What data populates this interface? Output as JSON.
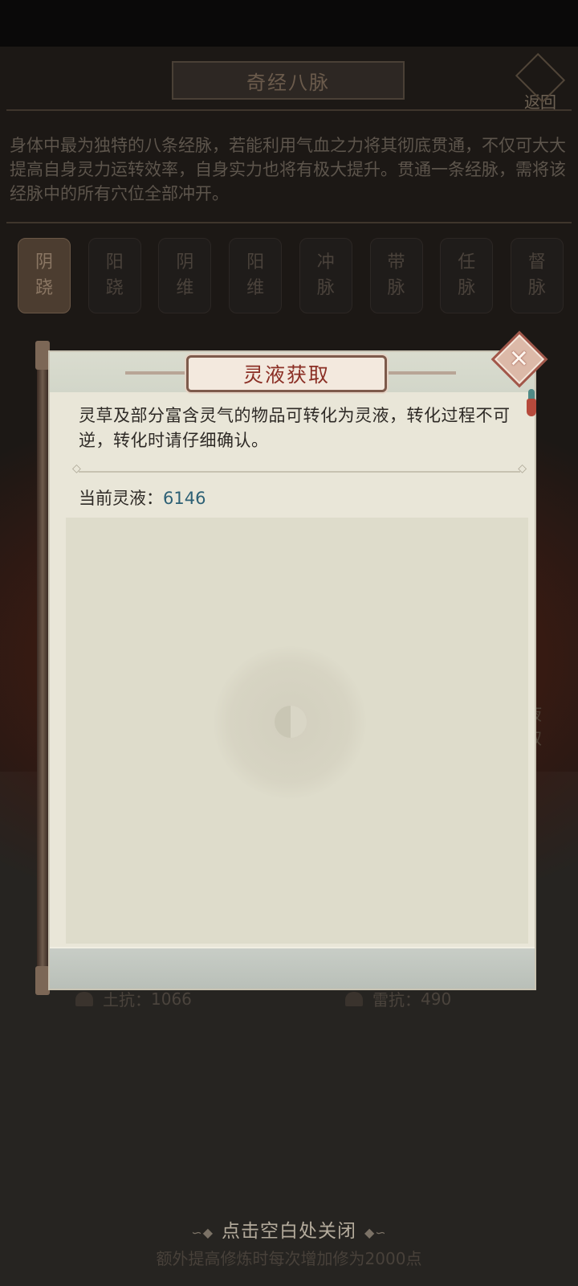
{
  "background": {
    "title": "奇经八脉",
    "back_label": "返回",
    "description": "身体中最为独特的八条经脉，若能利用气血之力将其彻底贯通，不仅可大大提高自身灵力运转效率，自身实力也将有极大提升。贯通一条经脉，需将该经脉中的所有穴位全部冲开。",
    "tabs": [
      {
        "label": "阴\n跷",
        "active": true
      },
      {
        "label": "阳\n跷",
        "active": false
      },
      {
        "label": "阴\n维",
        "active": false
      },
      {
        "label": "阳\n维",
        "active": false
      },
      {
        "label": "冲\n脉",
        "active": false
      },
      {
        "label": "带\n脉",
        "active": false
      },
      {
        "label": "任\n脉",
        "active": false
      },
      {
        "label": "督\n脉",
        "active": false
      }
    ],
    "stats": {
      "earth_label": "土抗：",
      "earth_value": "1066",
      "thunder_label": "雷抗：",
      "thunder_value": "490"
    },
    "side_button_label": "液\n取",
    "bottom_text": "额外提高修炼时每次增加修为2000点"
  },
  "dialog": {
    "title": "灵液获取",
    "description": "灵草及部分富含灵气的物品可转化为灵液，转化过程不可逆，转化时请仔细确认。",
    "current_label": "当前灵液：",
    "current_value": "6146",
    "close_icon": "close-x-icon"
  },
  "close_hint": "点击空白处关闭",
  "colors": {
    "title_red": "#8b2f25",
    "value_blue": "#2d6075",
    "paper": "#e9e6d8"
  }
}
